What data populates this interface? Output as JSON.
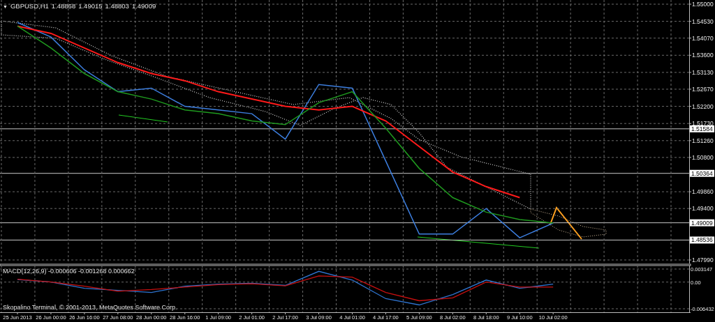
{
  "chart": {
    "menu_marker": "▼",
    "symbol": "GBPUSD,H1",
    "ohlc": [
      "1.48868",
      "1.49015",
      "1.48803",
      "1.49009"
    ],
    "level_lines": [
      {
        "label": "1.51584"
      },
      {
        "label": "1.50364"
      },
      {
        "label": "1.49009"
      },
      {
        "label": "1.48536"
      }
    ],
    "chart_data": {
      "type": "line",
      "grid": true,
      "series": [
        {
          "color": "#3d7fe0",
          "values": [
            1.545,
            1.541,
            1.532,
            1.526,
            1.527,
            1.522,
            1.521,
            1.52,
            1.513,
            1.528,
            1.527,
            1.507,
            1.487,
            1.487,
            1.494,
            1.486,
            1.49
          ]
        },
        {
          "color": "#ff1a1a",
          "values": [
            1.544,
            1.542,
            1.538,
            1.534,
            1.531,
            1.529,
            1.526,
            1.524,
            1.522,
            1.521,
            1.522,
            1.518,
            1.511,
            1.504,
            1.5,
            1.497,
            null
          ]
        },
        {
          "color": "#1f9a1f",
          "values": [
            1.544,
            1.538,
            1.531,
            1.526,
            1.524,
            1.521,
            1.52,
            1.518,
            1.517,
            1.523,
            1.526,
            1.516,
            1.505,
            1.497,
            1.493,
            1.491,
            1.49
          ]
        }
      ],
      "ylim": [
        1.4799,
        1.55
      ],
      "yticks": [
        {
          "value": 1.55,
          "label": "1.55000"
        },
        {
          "value": 1.5453,
          "label": "1.54530"
        },
        {
          "value": 1.5407,
          "label": "1.54070"
        },
        {
          "value": 1.536,
          "label": "1.53600"
        },
        {
          "value": 1.5313,
          "label": "1.53130"
        },
        {
          "value": 1.5267,
          "label": "1.52670"
        },
        {
          "value": 1.522,
          "label": "1.52200"
        },
        {
          "value": 1.5173,
          "label": "1.51730"
        },
        {
          "value": 1.5126,
          "label": "1.51260"
        },
        {
          "value": 1.508,
          "label": "1.50800"
        },
        {
          "value": 1.4986,
          "label": "1.49860"
        },
        {
          "value": 1.494,
          "label": "1.49400"
        },
        {
          "value": 1.4799,
          "label": "1.47990"
        }
      ]
    }
  },
  "macd": {
    "title": "MACD(12,26,9)",
    "values": [
      "-0.000606",
      "-0.001268",
      "0.000662"
    ],
    "chart_data": {
      "type": "line",
      "grid": true,
      "categories": [
        "25 Jun 2013",
        "26 Jun 00:00",
        "26 Jun 16:00",
        "27 Jun 08:00",
        "28 Jun 00:00",
        "28 Jun 16:00",
        "1 Jul 09:00",
        "2 Jul 01:00",
        "2 Jul 17:00",
        "3 Jul 09:00",
        "4 Jul 01:00",
        "4 Jul 17:00",
        "5 Jul 09:00",
        "8 Jul 02:00",
        "8 Jul 18:00",
        "9 Jul 10:00",
        "10 Jul 02:00"
      ],
      "series": [
        {
          "color": "#2f74d0",
          "values": [
            0.0006,
            0.0,
            -0.0015,
            -0.002,
            -0.0025,
            -0.001,
            -0.0005,
            -0.0003,
            -0.0008,
            0.0026,
            0.0005,
            -0.004,
            -0.0055,
            -0.003,
            0.0005,
            -0.0015,
            -0.0005
          ]
        },
        {
          "color": "#c81010",
          "values": [
            0.0007,
            0.0,
            -0.001,
            -0.0022,
            -0.0018,
            -0.0012,
            -0.0006,
            -0.0004,
            -0.0009,
            0.0015,
            0.0012,
            -0.0025,
            -0.0045,
            -0.0038,
            0.0,
            -0.0012,
            -0.0012
          ]
        }
      ],
      "ylim": [
        -0.006432,
        0.003147
      ],
      "yticks": [
        {
          "value": 0.003147,
          "label": "0.003147"
        },
        {
          "value": 0,
          "label": "0.00"
        },
        {
          "value": -0.006432,
          "label": "-0.006432"
        }
      ]
    },
    "copyright": "Skopalino Terminal, © 2001-2013, MetaQuotes Software Corp."
  }
}
